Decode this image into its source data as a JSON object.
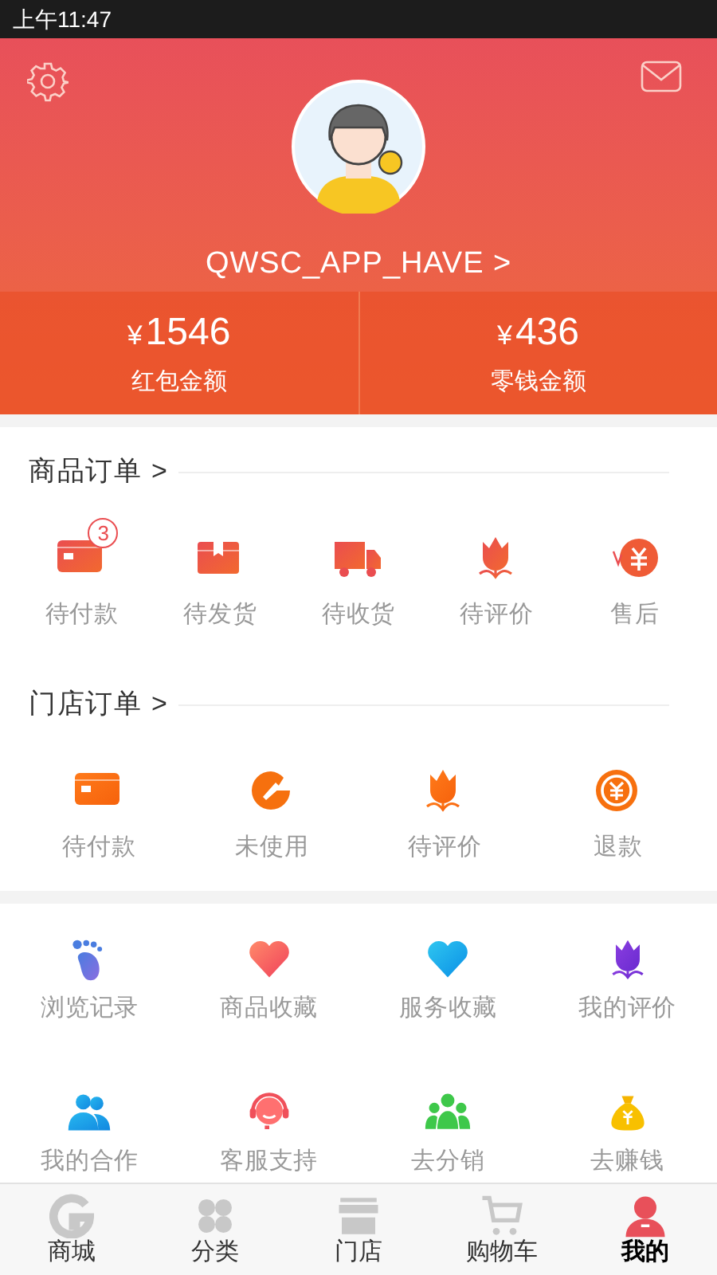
{
  "status_bar": {
    "time": "上午11:47"
  },
  "profile": {
    "username": "QWSC_APP_HAVE >"
  },
  "balances": [
    {
      "amount": "1546",
      "currency": "¥",
      "label": "红包金额"
    },
    {
      "amount": "436",
      "currency": "¥",
      "label": "零钱金额"
    }
  ],
  "product_orders": {
    "title": "商品订单 >",
    "items": [
      {
        "label": "待付款",
        "badge": "3"
      },
      {
        "label": "待发货"
      },
      {
        "label": "待收货"
      },
      {
        "label": "待评价"
      },
      {
        "label": "售后"
      }
    ]
  },
  "store_orders": {
    "title": "门店订单 >",
    "items": [
      {
        "label": "待付款"
      },
      {
        "label": "未使用"
      },
      {
        "label": "待评价"
      },
      {
        "label": "退款"
      }
    ]
  },
  "services": [
    [
      {
        "label": "浏览记录"
      },
      {
        "label": "商品收藏"
      },
      {
        "label": "服务收藏"
      },
      {
        "label": "我的评价"
      }
    ],
    [
      {
        "label": "我的合作"
      },
      {
        "label": "客服支持"
      },
      {
        "label": "去分销"
      },
      {
        "label": "去赚钱"
      }
    ]
  ],
  "tab_bar": [
    {
      "label": "商城",
      "selected": false
    },
    {
      "label": "分类",
      "selected": false
    },
    {
      "label": "门店",
      "selected": false
    },
    {
      "label": "购物车",
      "selected": false
    },
    {
      "label": "我的",
      "selected": true
    }
  ]
}
